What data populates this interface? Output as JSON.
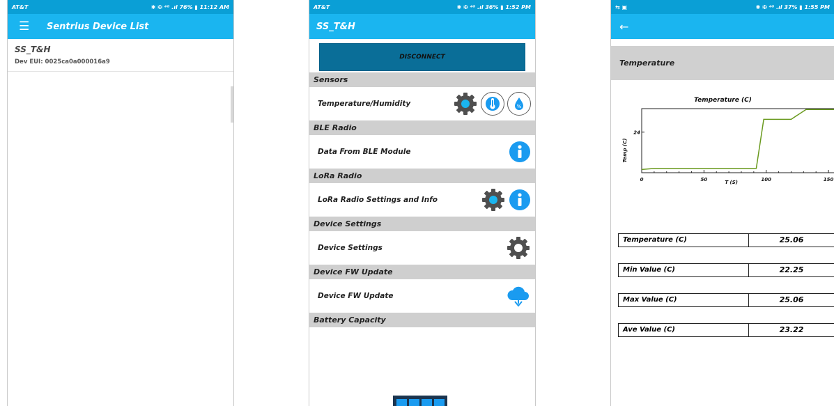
{
  "screen1": {
    "status": {
      "carrier": "AT&T",
      "right": "✱ ✠ ⁴ᴳ .ıl 76% ▮ 11:12 AM"
    },
    "title": "Sentrius Device List",
    "device": {
      "name": "SS_T&H",
      "eui": "Dev EUI: 0025ca0a000016a9"
    }
  },
  "screen2": {
    "status": {
      "carrier": "AT&T",
      "right": "✱ ✠ ⁴ᴳ .ıl 36% ▮ 1:52 PM"
    },
    "title": "SS_T&H",
    "disconnect_label": "DISCONNECT",
    "sections": {
      "sensors": "Sensors",
      "ble": "BLE Radio",
      "lora": "LoRa Radio",
      "device_settings": "Device Settings",
      "fw": "Device FW Update",
      "battery": "Battery Capacity"
    },
    "rows": {
      "temp_humidity": "Temperature/Humidity",
      "ble_data": "Data From BLE Module",
      "lora_settings": "LoRa Radio Settings and Info",
      "device_settings": "Device Settings",
      "fw_update": "Device FW Update"
    },
    "icons": [
      "gear-icon",
      "thermometer-icon",
      "humidity-icon",
      "info-icon",
      "cloud-download-icon",
      "battery-icon"
    ],
    "colors": {
      "accent": "#1ab5f0",
      "info": "#1a9bf0",
      "gear": "#4f4f4f"
    }
  },
  "screen3": {
    "status": {
      "left": "⇆ ▣",
      "right": "✱ ✠ ⁴ᴳ .ıl 37% ▮ 1:55 PM"
    },
    "header": "Temperature",
    "readings": [
      {
        "label": "Temperature (C)",
        "value": "25.06"
      },
      {
        "label": "Min Value (C)",
        "value": "22.25"
      },
      {
        "label": "Max Value (C)",
        "value": "25.06"
      },
      {
        "label": "Ave Value (C)",
        "value": "23.22"
      }
    ]
  },
  "chart_data": {
    "type": "line",
    "title": "Temperature (C)",
    "xlabel": "T (S)",
    "ylabel": "Temp (C)",
    "x_ticks": [
      "0",
      "50",
      "100",
      "150"
    ],
    "y_ticks": [
      "24"
    ],
    "xlim": [
      0,
      155
    ],
    "ylim": [
      22.1,
      25.1
    ],
    "grid": false,
    "series": [
      {
        "color": "#6a9a1f",
        "x": [
          0,
          10,
          20,
          50,
          92,
          98,
          120,
          132,
          155
        ],
        "y": [
          22.25,
          22.3,
          22.3,
          22.3,
          22.3,
          24.6,
          24.6,
          25.06,
          25.06
        ]
      }
    ]
  }
}
